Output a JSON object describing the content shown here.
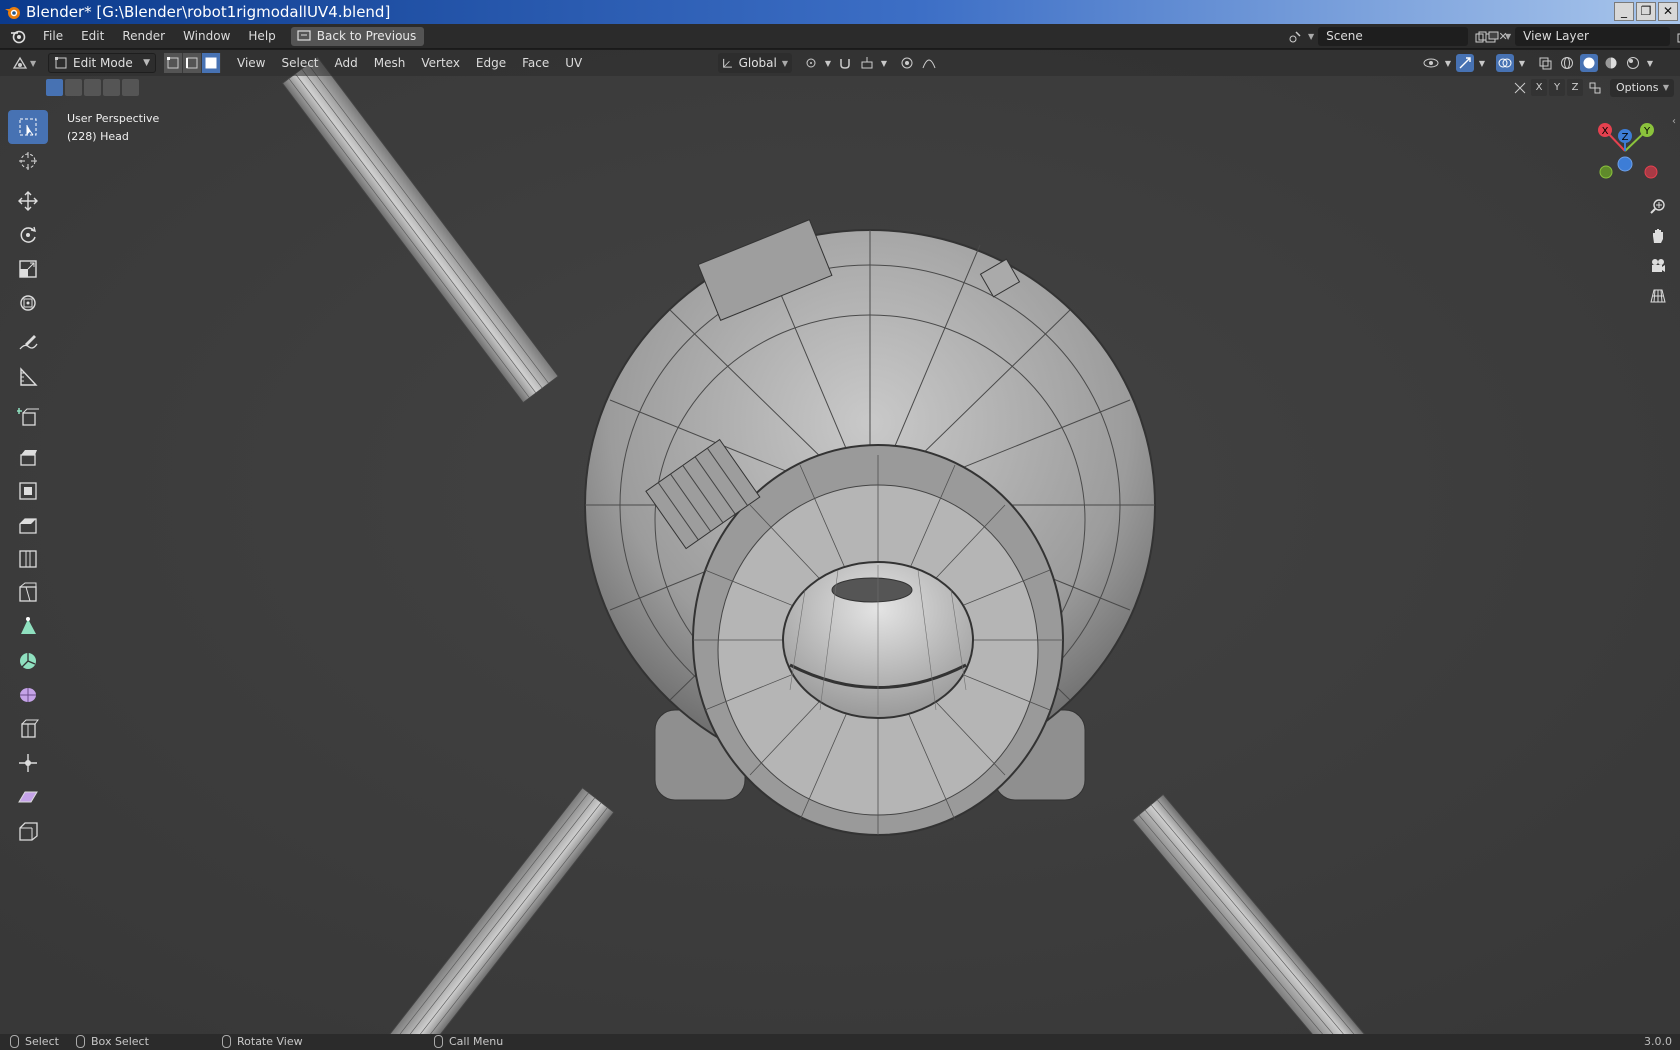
{
  "window": {
    "title": "Blender* [G:\\Blender\\robot1rigmodallUV4.blend]",
    "buttons": [
      "_",
      "❐",
      "✕"
    ]
  },
  "menubar": {
    "items": [
      "File",
      "Edit",
      "Render",
      "Window",
      "Help"
    ],
    "back_button": "Back to Previous",
    "scene": "Scene",
    "view_layer": "View Layer"
  },
  "viewport_header": {
    "mode": "Edit Mode",
    "menus": [
      "View",
      "Select",
      "Add",
      "Mesh",
      "Vertex",
      "Edge",
      "Face",
      "UV"
    ],
    "orientation": "Global",
    "axis_buttons": [
      "X",
      "Y",
      "Z"
    ],
    "options": "Options"
  },
  "viewport": {
    "perspective": "User Perspective",
    "object": "(228) Head"
  },
  "toolbar": {
    "tools": [
      "select-box-tool",
      "cursor-tool",
      "move-tool",
      "rotate-tool",
      "scale-tool",
      "transform-tool",
      "annotate-tool",
      "measure-tool",
      "add-cube-tool",
      "extrude-tool",
      "inset-tool",
      "bevel-tool",
      "loop-cut-tool",
      "knife-tool",
      "poly-build-tool",
      "spin-tool",
      "smooth-tool",
      "edge-slide-tool",
      "shrink-fatten-tool",
      "shear-tool",
      "rip-region-tool"
    ]
  },
  "gizmo": {
    "axes": [
      "X",
      "Y",
      "Z"
    ],
    "colors": {
      "x": "#e5414f",
      "y": "#8bc33c",
      "z": "#3d7dd6"
    }
  },
  "statusbar": {
    "select": "Select",
    "box_select": "Box Select",
    "rotate_view": "Rotate View",
    "call_menu": "Call Menu",
    "version": "3.0.0"
  },
  "colors": {
    "accent": "#4772b3",
    "background": "#3d3d3d"
  }
}
